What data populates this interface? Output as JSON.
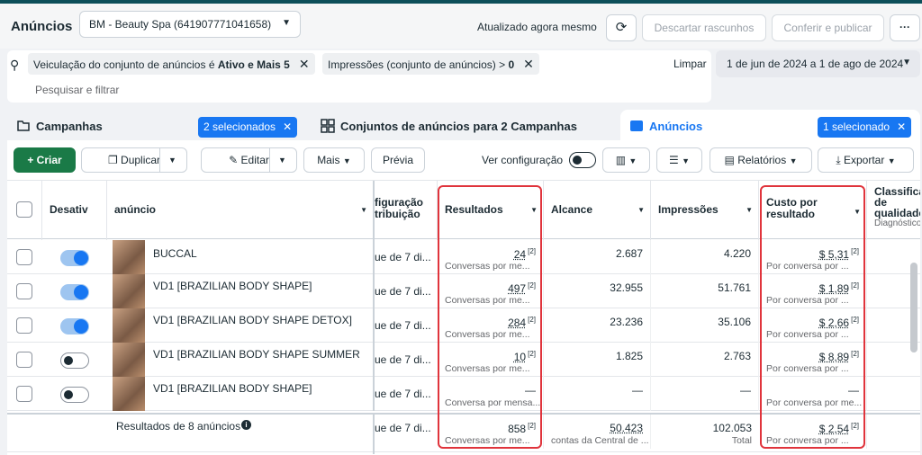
{
  "header": {
    "title": "Anúncios",
    "account": "BM - Beauty Spa (641907771041658)",
    "updated": "Atualizado agora mesmo",
    "discard": "Descartar rascunhos",
    "review": "Conferir e publicar",
    "more": "···"
  },
  "filters": {
    "chip1_text": "Veiculação do conjunto de anúncios é ",
    "chip1_bold": "Ativo e Mais 5",
    "chip2_text": "Impressões (conjunto de anúncios) > ",
    "chip2_bold": "0",
    "clear": "Limpar",
    "placeholder": "Pesquisar e filtrar",
    "date_range": "1 de jun de 2024 a 1 de ago de 2024"
  },
  "tabs": {
    "campaigns": "Campanhas",
    "campaigns_badge": "2 selecionados",
    "adsets": "Conjuntos de anúncios para 2 Campanhas",
    "ads": "Anúncios",
    "ads_badge": "1 selecionado"
  },
  "toolbar": {
    "create": "Criar",
    "duplicate": "Duplicar",
    "edit": "Editar",
    "more": "Mais",
    "preview": "Prévia",
    "view_setup": "Ver configuração",
    "reports": "Relatórios",
    "export": "Exportar"
  },
  "columns": {
    "off": "Desativ",
    "ad": "anúncio",
    "attribution": "figuração tribuição",
    "results": "Resultados",
    "reach": "Alcance",
    "impressions": "Impressões",
    "cost": "Custo por resultado",
    "quality": "Classifica de qualidade",
    "quality_sub": "Diagnóstico"
  },
  "rows": [
    {
      "on": true,
      "name": "BUCCAL",
      "attr": "ue de 7 di...",
      "results": "24",
      "results_sub": "Conversas por me...",
      "reach": "2.687",
      "impressions": "4.220",
      "cost": "$ 5,31",
      "cost_sub": "Por conversa por ..."
    },
    {
      "on": true,
      "name": "VD1 [BRAZILIAN BODY SHAPE]",
      "attr": "ue de 7 di...",
      "results": "497",
      "results_sub": "Conversas por me...",
      "reach": "32.955",
      "impressions": "51.761",
      "cost": "$ 1,89",
      "cost_sub": "Por conversa por ..."
    },
    {
      "on": true,
      "name": "VD1 [BRAZILIAN BODY SHAPE DETOX]",
      "attr": "ue de 7 di...",
      "results": "284",
      "results_sub": "Conversas por me...",
      "reach": "23.236",
      "impressions": "35.106",
      "cost": "$ 2,66",
      "cost_sub": "Por conversa por ..."
    },
    {
      "on": false,
      "name": "VD1 [BRAZILIAN BODY SHAPE SUMMER",
      "attr": "ue de 7 di...",
      "results": "10",
      "results_sub": "Conversas por me...",
      "reach": "1.825",
      "impressions": "2.763",
      "cost": "$ 8,89",
      "cost_sub": "Por conversa por ..."
    },
    {
      "on": false,
      "name": "VD1 [BRAZILIAN BODY SHAPE]",
      "attr": "ue de 7 di...",
      "results": "—",
      "results_sub": "Conversa por mensa...",
      "reach": "—",
      "impressions": "—",
      "cost": "—",
      "cost_sub": "Por conversa por me..."
    }
  ],
  "total": {
    "label": "Resultados de 8 anúncios",
    "attr": "ue de 7 di...",
    "results": "858",
    "results_sub": "Conversas por me...",
    "reach": "50.423",
    "reach_sub": "contas da Central de ...",
    "impressions": "102.053",
    "impressions_sub": "Total",
    "cost": "$ 2,54",
    "cost_sub": "Por conversa por ..."
  },
  "footnote": "[2]",
  "colors": {
    "accent": "#1877f2",
    "create": "#1a7a47",
    "highlight": "#e0343c"
  }
}
